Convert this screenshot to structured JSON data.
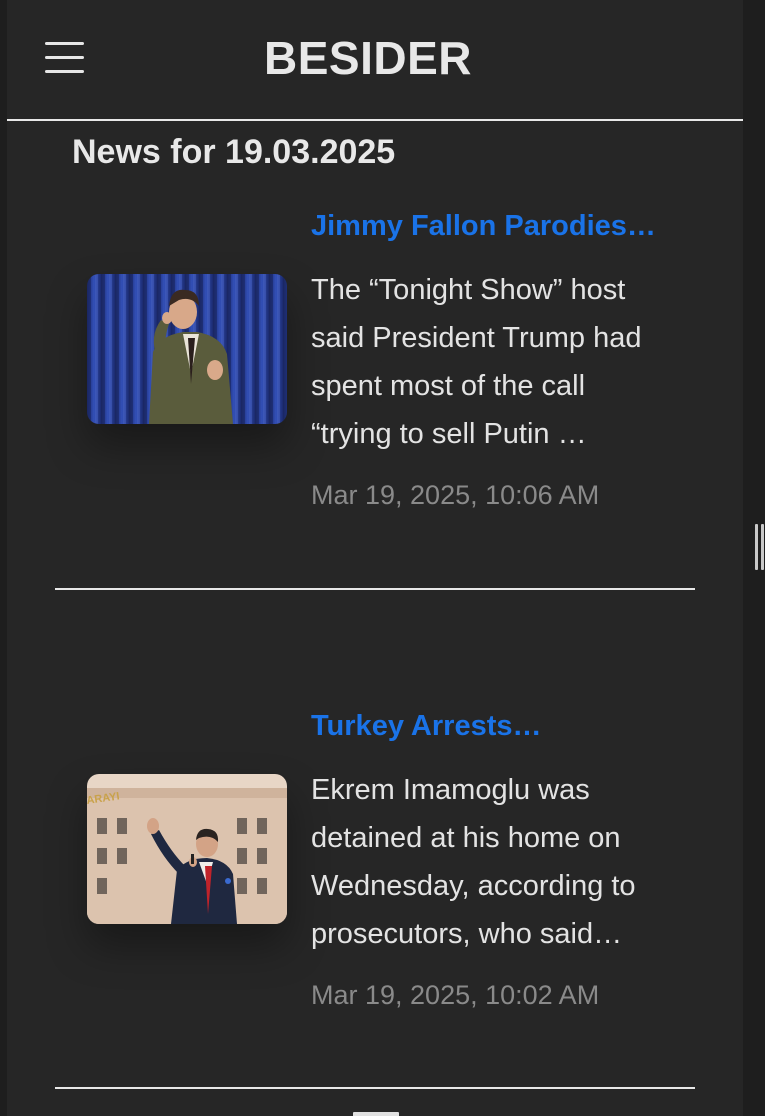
{
  "header": {
    "logo": "BESIDER",
    "menu_icon": "hamburger-menu-icon"
  },
  "section_title": "News for 19.03.2025",
  "articles": [
    {
      "title": "Jimmy Fallon Parodies…",
      "description": "The “Tonight Show” host said President Trump had spent most of the call “trying to sell Putin …",
      "date": "Mar 19, 2025, 10:06 AM"
    },
    {
      "title": "Turkey Arrests…",
      "description": "Ekrem Imamoglu was detained at his home on Wednesday, according to prosecutors, who said…",
      "date": "Mar 19, 2025, 10:02 AM",
      "image_sign_text": "ARAYI"
    }
  ],
  "colors": {
    "background": "#262626",
    "link": "#1a73e8",
    "text": "#e3e3e3",
    "date": "#8a8a8a"
  }
}
